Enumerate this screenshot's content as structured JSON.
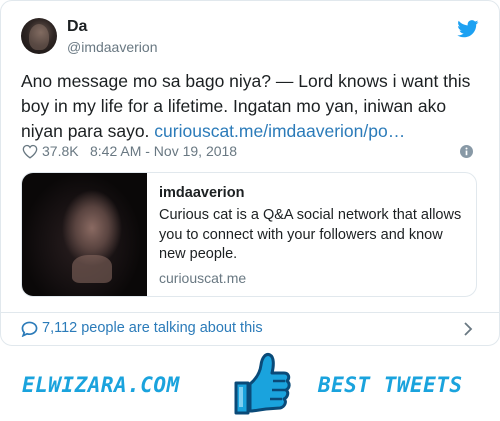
{
  "author": {
    "name": "Da",
    "handle": "@imdaaverion"
  },
  "tweet": {
    "text": "Ano message mo sa bago niya? — Lord knows i want this boy in my life for a lifetime. Ingatan mo yan, iniwan ako niyan para sayo. ",
    "link": "curiouscat.me/imdaaverion/po…",
    "likes": "37.8K",
    "timestamp": "8:42 AM - Nov 19, 2018"
  },
  "link_card": {
    "title": "imdaaverion",
    "description": "Curious cat is a Q&A social network that allows you to connect with your followers and know new people.",
    "domain": "curiouscat.me"
  },
  "footer": {
    "talking": "7,112 people are talking about this"
  },
  "banner": {
    "left": "ELWIZARA.COM",
    "right": "BEST TWEETS"
  },
  "icons": {
    "brand": "twitter-bird-icon",
    "like": "heart-icon",
    "info": "info-icon",
    "comment": "comment-icon",
    "chevron": "chevron-right-icon",
    "thumbs": "thumbs-up-icon"
  },
  "colors": {
    "link": "#2b7bb9",
    "muted": "#697882",
    "text": "#1c2022",
    "twitter_blue": "#1da1f2",
    "banner_blue": "#1aa3dd"
  }
}
